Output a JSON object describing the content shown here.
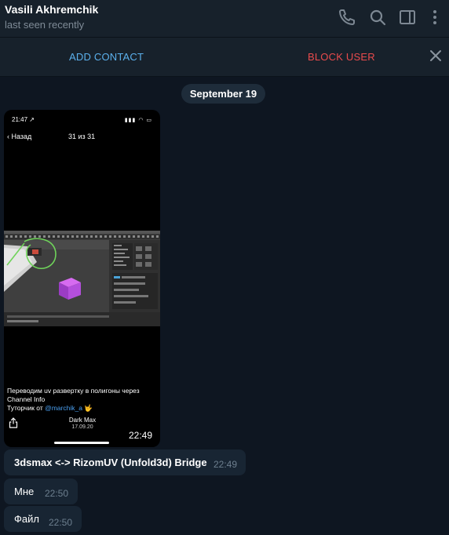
{
  "header": {
    "name": "Vasili Akhremchik",
    "status": "last seen recently",
    "icons": [
      "phone-icon",
      "search-icon",
      "sidebar-icon",
      "more-vertical-icon"
    ]
  },
  "actions": {
    "add_contact": "ADD CONTACT",
    "block_user": "BLOCK USER",
    "close_icon": "close-icon"
  },
  "date_divider": "September 19",
  "photo_message": {
    "status_time": "21:47 ↗",
    "back_label": "Назад",
    "counter": "31 из 31",
    "caption_line1": "Переводим uv развертку в полигоны через",
    "caption_line2": "Channel Info",
    "caption_prefix": "Туторчик от ",
    "caption_link": "@marchik_a",
    "caption_emoji": "🤟",
    "author": "Dark Max",
    "author_date": "17.09.20",
    "time": "22:49"
  },
  "messages": [
    {
      "text": "3dsmax <-> RizomUV (Unfold3d) Bridge",
      "time": "22:49"
    },
    {
      "text": "Мне",
      "time": "22:50"
    },
    {
      "text": "Файл",
      "time": "22:50"
    }
  ],
  "colors": {
    "background": "#0e1621",
    "header": "#17212b",
    "bubble": "#182533",
    "accent": "#5bb0ec",
    "danger": "#ea4b4d"
  }
}
